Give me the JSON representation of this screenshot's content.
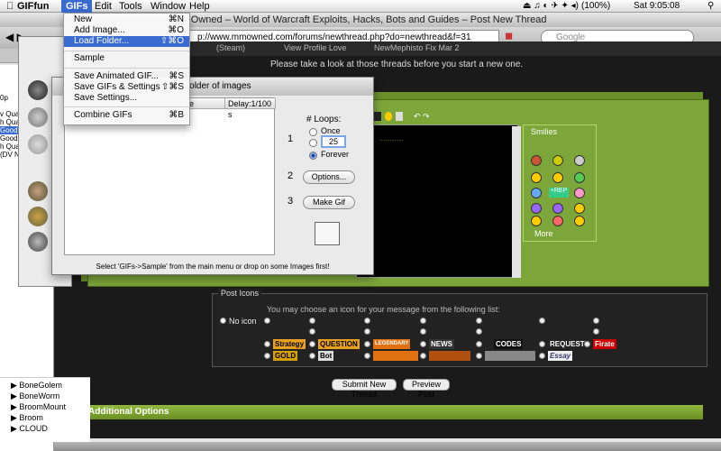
{
  "menubar": {
    "app_name": "GIFfun",
    "items": [
      "GIFs",
      "Edit",
      "Tools",
      "Window",
      "Help"
    ],
    "battery": "(100%)",
    "clock": "Sat 9:05:08"
  },
  "gifs_menu": {
    "items": [
      {
        "label": "New",
        "shortcut": "⌘N"
      },
      {
        "label": "Add Image...",
        "shortcut": "⌘O"
      },
      {
        "label": "Load Folder...",
        "shortcut": "⇧⌘O"
      },
      {
        "label": "Sample",
        "shortcut": ""
      },
      {
        "label": "Save Animated GIF...",
        "shortcut": "⌘S"
      },
      {
        "label": "Save GIFs & Settings",
        "shortcut": "⇧⌘S"
      },
      {
        "label": "Save Settings...",
        "shortcut": ""
      },
      {
        "label": "Combine GIFs",
        "shortcut": "⌘B"
      }
    ]
  },
  "browser": {
    "title": "MMOwned – World of Warcraft Exploits, Hacks, Bots and Guides – Post New Thread",
    "url": "p://www.mmowned.com/forums/newthread.php?do=newthread&f=31",
    "search_placeholder": "Google",
    "page_notice": "Please take a look at those threads before you start a new one.",
    "tabs_text": [
      "(Steam)",
      "View Profile Love",
      "NewMephisto Fix Mar 2"
    ],
    "smilies_label": "Smilies",
    "smilies_more": "More",
    "post_icons_legend": "Post Icons",
    "post_icons_desc": "You may choose an icon for your message from the following list:",
    "no_icon": "No icon",
    "post_icon_badges": [
      "Strategy",
      "QUESTION",
      "LEGENDARY",
      "NEWS",
      "CODES",
      "REQUEST",
      "Firate",
      "GOLD",
      "Bot",
      "Essay"
    ],
    "submit_button": "Submit New Thread",
    "preview_button": "Preview Post",
    "additional_options": "Additional Options"
  },
  "giffun": {
    "window_title": "on folder of images",
    "columns": [
      "ge",
      "Delay:1/100 s"
    ],
    "step1": "1",
    "step2": "2",
    "step3": "3",
    "loops_label": "# Loops:",
    "loop_once": "Once",
    "loop_count": "25",
    "loop_forever": "Forever",
    "options_button": "Options...",
    "make_gif_button": "Make Gif",
    "status": "Select 'GIFs->Sample' from the main menu or drop on some Images first!"
  },
  "sidebar": {
    "items": [
      "0p",
      "v Qualit",
      "h Qualit",
      "Good Qu",
      "Good Qu",
      "h Qualit",
      "(DV NT"
    ],
    "tree": [
      "BoneGolem",
      "BoneWorm",
      "BroomMount",
      "Broom",
      "CLOUD"
    ]
  }
}
